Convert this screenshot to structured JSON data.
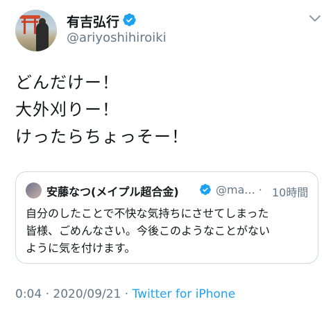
{
  "tweet": {
    "author": {
      "display_name": "有吉弘行",
      "handle": "@ariyoshihiroiki",
      "verified": true
    },
    "text_lines": [
      "どんだけー！",
      "大外刈りー！",
      "けったらちょっそー！"
    ],
    "quoted_tweet": {
      "display_name": "安藤なつ(メイプル超合金)",
      "handle": "@ma...",
      "separator": "·",
      "time": "10時間",
      "text_lines": [
        "自分のしたことで不快な気持ちにさせてしまった",
        "皆様、ごめんなさい。今後このようなことがない",
        "ように気を付けます。"
      ]
    },
    "meta": {
      "time": "0:04",
      "separator": " · ",
      "date": "2020/09/21",
      "separator2": " · ",
      "source": "Twitter for iPhone"
    }
  },
  "colors": {
    "accent": "#1da1f2",
    "secondary_text": "#657786",
    "primary_text": "#14171a",
    "border": "#cfd9de"
  },
  "icons": {
    "verified": "verified-badge-icon",
    "more": "chevron-down-icon"
  }
}
